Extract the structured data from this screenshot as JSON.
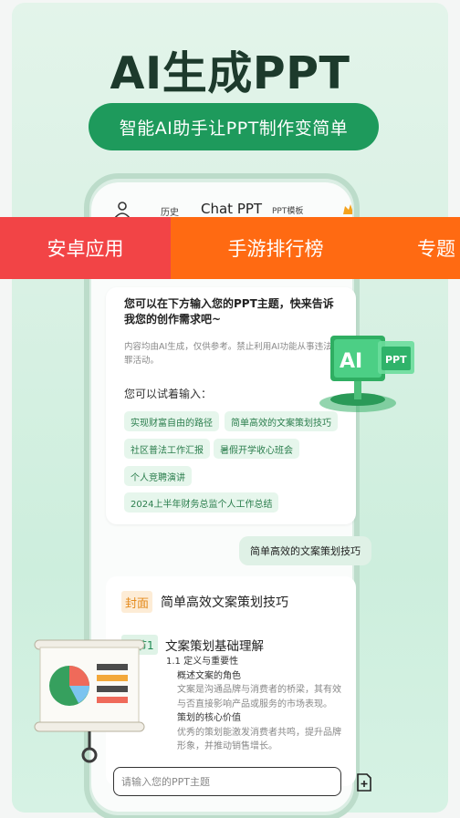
{
  "headline": "AI生成PPT",
  "subtitle": "智能AI助手让PPT制作变简单",
  "app_header": {
    "history": "历史",
    "title": "Chat PPT",
    "template": "PPT模板"
  },
  "category_tabs": [
    "安卓应用",
    "手游排行榜",
    "专题"
  ],
  "welcome": {
    "intro": "您可以在下方输入您的PPT主题，快来告诉我您的创作需求吧~",
    "note": "内容均由AI生成，仅供参考。禁止利用AI功能从事违法犯罪活动。",
    "try_label": "您可以试着输入：",
    "suggestions": [
      "实现财富自由的路径",
      "简单高效的文案策划技巧",
      "社区普法工作汇报",
      "暑假开学收心班会",
      "个人竞聘演讲",
      "2024上半年财务总监个人工作总结"
    ]
  },
  "ai_badge": {
    "ai": "AI",
    "ppt": "PPT"
  },
  "user_message": "简单高效的文案策划技巧",
  "outline": {
    "cover_tag": "封面",
    "cover_title": "简单高效文案策划技巧",
    "section_tag": "章节1",
    "section_title": "文案策划基础理解",
    "lines": [
      "1.1 定义与重要性",
      "概述文案的角色",
      "文案是沟通品牌与消费者的桥梁，其有效与否直接影响产品或服务的市场表现。",
      "策划的核心价值",
      "优秀的策划能激发消费者共鸣，提升品牌形象，并推动销售增长。"
    ]
  },
  "input": {
    "placeholder": "请输入您的PPT主题"
  }
}
